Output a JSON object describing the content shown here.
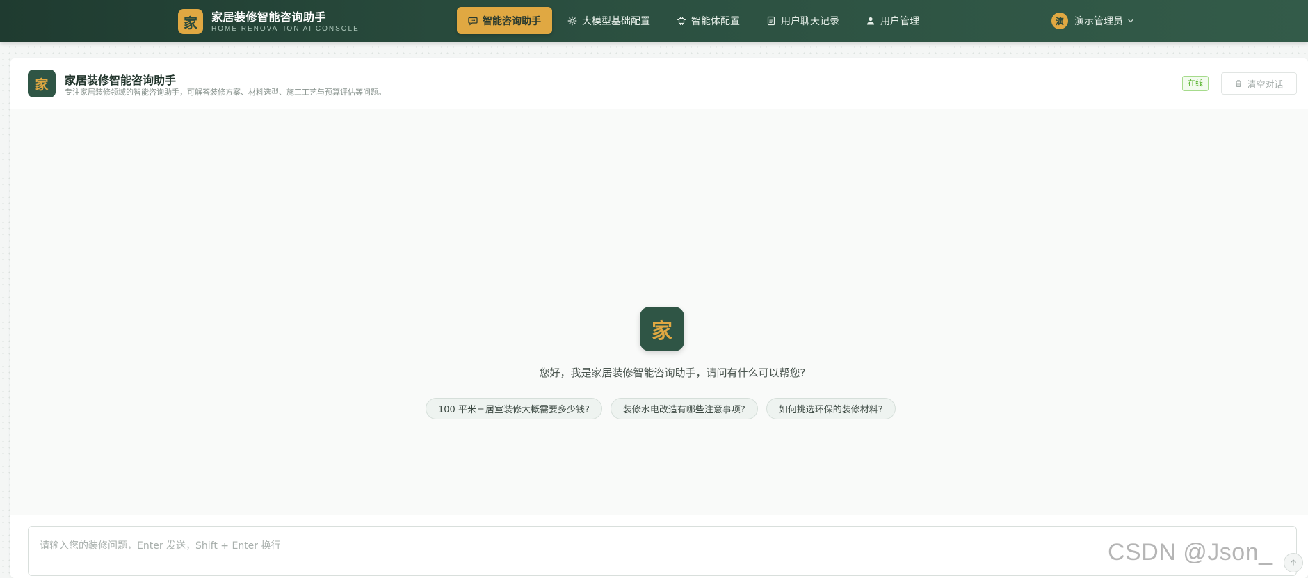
{
  "brand": {
    "logo_char": "家",
    "title": "家居装修智能咨询助手",
    "subtitle": "HOME RENOVATION AI CONSOLE"
  },
  "nav": {
    "items": [
      {
        "label": "智能咨询助手",
        "icon": "chat-bubble-icon",
        "active": true
      },
      {
        "label": "大模型基础配置",
        "icon": "gear-icon",
        "active": false
      },
      {
        "label": "智能体配置",
        "icon": "chip-icon",
        "active": false
      },
      {
        "label": "用户聊天记录",
        "icon": "document-icon",
        "active": false
      },
      {
        "label": "用户管理",
        "icon": "user-icon",
        "active": false
      }
    ]
  },
  "user": {
    "avatar_char": "演",
    "name": "演示管理员",
    "caret_icon": "chevron-down-icon"
  },
  "assistant": {
    "logo_char": "家",
    "title": "家居装修智能咨询助手",
    "description": "专注家居装修领域的智能咨询助手，可解答装修方案、材料选型、施工工艺与预算评估等问题。",
    "status": "在线",
    "clear_label": "清空对话"
  },
  "welcome": {
    "logo_char": "家",
    "greeting": "您好，我是家居装修智能咨询助手，请问有什么可以帮您?",
    "suggestions": [
      "100 平米三居室装修大概需要多少钱?",
      "装修水电改造有哪些注意事项?",
      "如何挑选环保的装修材料?"
    ]
  },
  "input": {
    "placeholder": "请输入您的装修问题，Enter 发送，Shift + Enter 换行"
  },
  "watermark": "CSDN @Json_",
  "colors": {
    "topbar": "#2b4f40",
    "accent": "#e0a842",
    "brand_dark": "#2f5545",
    "status_green": "#52b127"
  }
}
